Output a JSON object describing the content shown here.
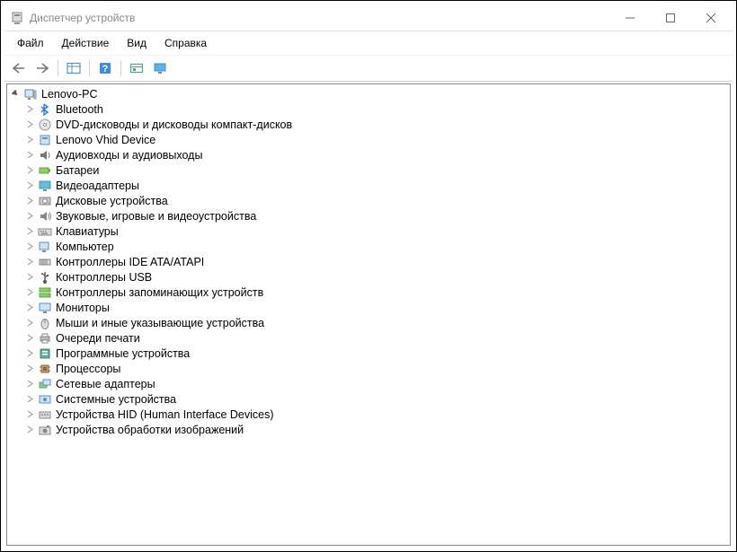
{
  "title": "Диспетчер устройств",
  "menu": {
    "file": "Файл",
    "action": "Действие",
    "view": "Вид",
    "help": "Справка"
  },
  "root": {
    "name": "Lenovo-PC"
  },
  "categories": [
    {
      "label": "Bluetooth",
      "icon": "bluetooth"
    },
    {
      "label": "DVD-дисководы и дисководы компакт-дисков",
      "icon": "disc"
    },
    {
      "label": "Lenovo Vhid Device",
      "icon": "device"
    },
    {
      "label": "Аудиовходы и аудиовыходы",
      "icon": "audio"
    },
    {
      "label": "Батареи",
      "icon": "battery"
    },
    {
      "label": "Видеоадаптеры",
      "icon": "display"
    },
    {
      "label": "Дисковые устройства",
      "icon": "hdd"
    },
    {
      "label": "Звуковые, игровые и видеоустройства",
      "icon": "sound"
    },
    {
      "label": "Клавиатуры",
      "icon": "keyboard"
    },
    {
      "label": "Компьютер",
      "icon": "computer"
    },
    {
      "label": "Контроллеры IDE ATA/ATAPI",
      "icon": "ide"
    },
    {
      "label": "Контроллеры USB",
      "icon": "usb"
    },
    {
      "label": "Контроллеры запоминающих устройств",
      "icon": "storage"
    },
    {
      "label": "Мониторы",
      "icon": "monitor"
    },
    {
      "label": "Мыши и иные указывающие устройства",
      "icon": "mouse"
    },
    {
      "label": "Очереди печати",
      "icon": "printer"
    },
    {
      "label": "Программные устройства",
      "icon": "software"
    },
    {
      "label": "Процессоры",
      "icon": "cpu"
    },
    {
      "label": "Сетевые адаптеры",
      "icon": "network"
    },
    {
      "label": "Системные устройства",
      "icon": "system"
    },
    {
      "label": "Устройства HID (Human Interface Devices)",
      "icon": "hid"
    },
    {
      "label": "Устройства обработки изображений",
      "icon": "imaging"
    }
  ]
}
